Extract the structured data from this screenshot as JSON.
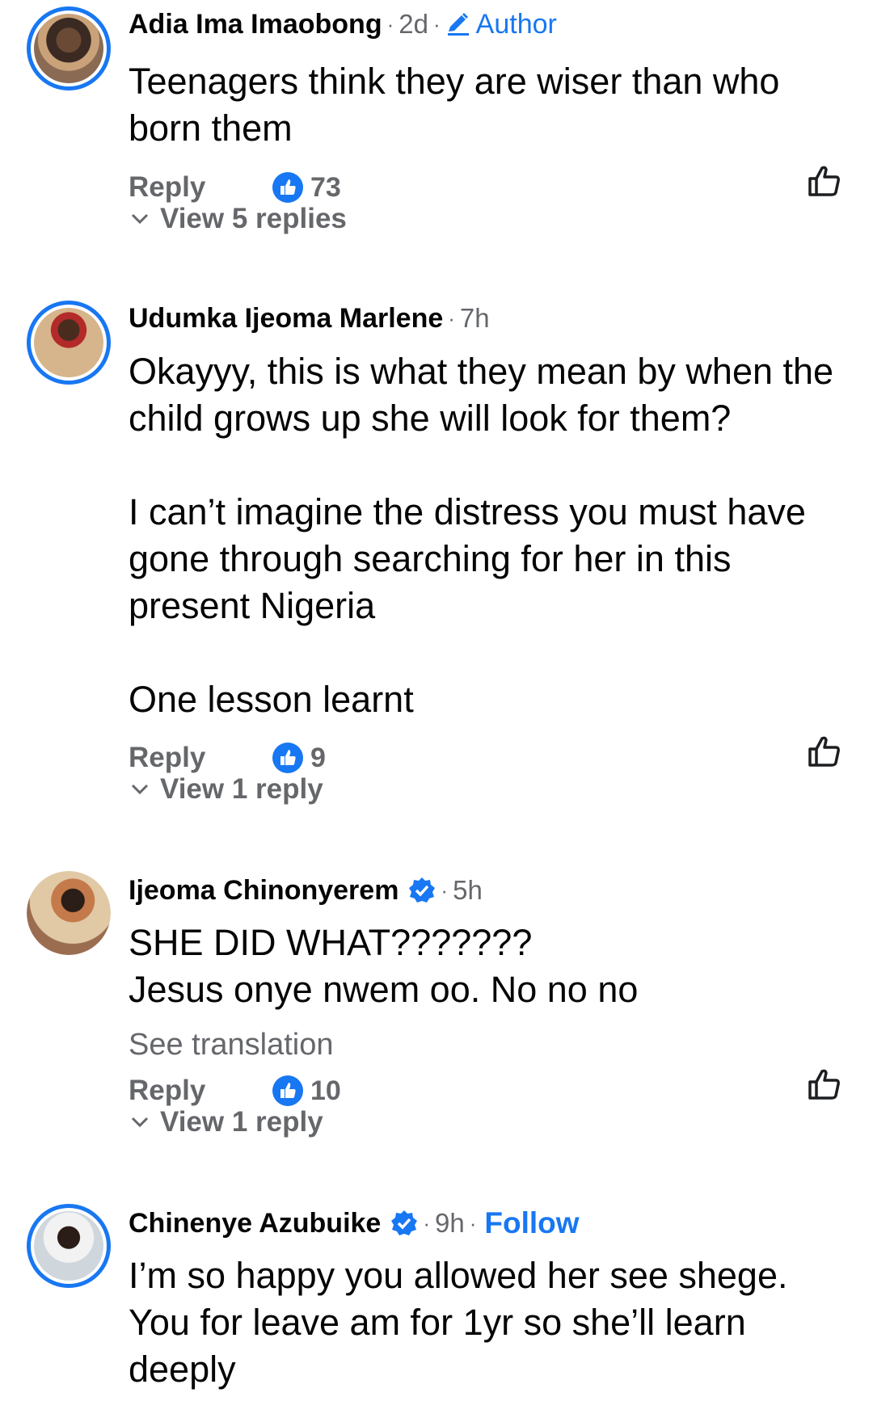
{
  "comments": [
    {
      "author": "Adia Ima Imaobong",
      "time": "2d",
      "badge": "Author",
      "text": [
        "Teenagers think they are wiser than who born them"
      ],
      "reply_label": "Reply",
      "likes": "73",
      "view_replies": "View 5 replies"
    },
    {
      "author": "Udumka Ijeoma Marlene",
      "time": "7h",
      "text": [
        "Okayyy, this is what they mean by when the child grows up she will look for them?",
        "I can’t imagine the distress you must have gone through searching for her in this present Nigeria",
        "One lesson learnt"
      ],
      "reply_label": "Reply",
      "likes": "9",
      "view_replies": "View 1 reply"
    },
    {
      "author": "Ijeoma Chinonyerem",
      "time": "5h",
      "text": [
        "SHE DID WHAT???????",
        "Jesus onye nwem oo. No no no"
      ],
      "see_translation": "See translation",
      "reply_label": "Reply",
      "likes": "10",
      "view_replies": "View 1 reply"
    },
    {
      "author": "Chinenye Azubuike",
      "time": "9h",
      "follow": "Follow",
      "text": [
        "I’m so happy you allowed her see shege. You for leave am for 1yr so she’ll learn deeply"
      ]
    }
  ],
  "colors": {
    "accent": "#1877f2",
    "muted": "#65676b",
    "text": "#050505"
  },
  "icons": [
    "pencil-icon",
    "like-reaction-icon",
    "thumbs-up-outline-icon",
    "chevron-down-icon",
    "verified-badge-icon"
  ]
}
